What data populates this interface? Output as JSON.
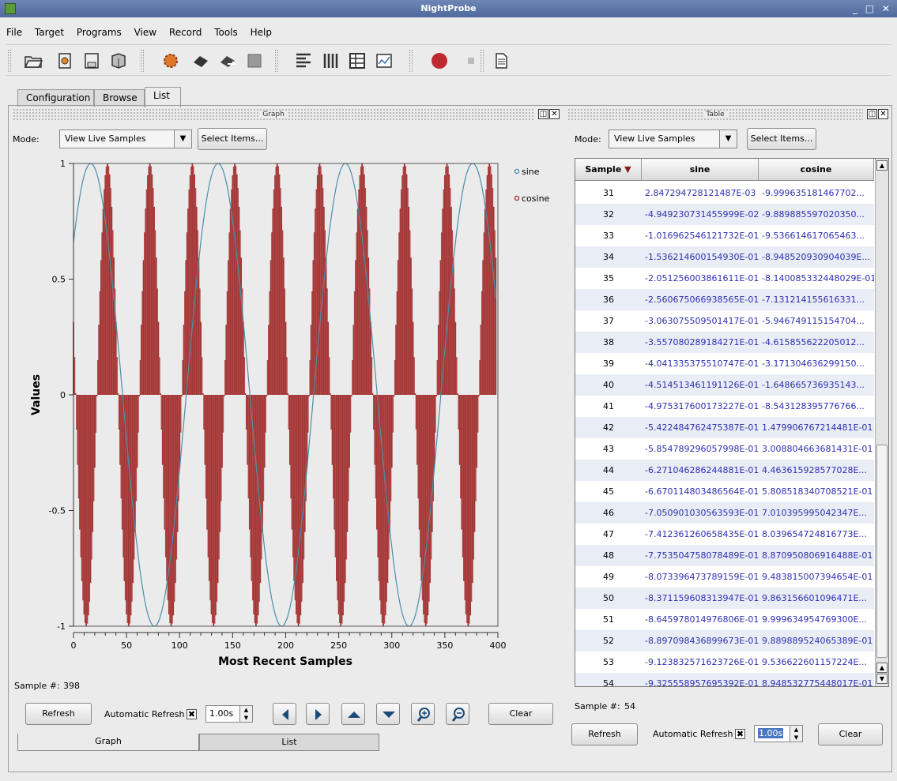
{
  "window": {
    "title": "NightProbe"
  },
  "menu": [
    "File",
    "Target",
    "Programs",
    "View",
    "Record",
    "Tools",
    "Help"
  ],
  "toolbar_icons": [
    "open-folder-icon",
    "target-icon",
    "save-icon",
    "cube-icon",
    "gear-icon",
    "chip-icon",
    "chip-arrow-icon",
    "memory-icon",
    "align-left-icon",
    "columns-icon",
    "table-icon",
    "graph-icon",
    "record-icon",
    "stop-icon",
    "document-icon"
  ],
  "tabs": [
    {
      "label": "Configuration",
      "active": false
    },
    {
      "label": "Browse",
      "active": false
    },
    {
      "label": "List",
      "active": true
    }
  ],
  "graph_panel": {
    "title": "Graph",
    "mode_label": "Mode:",
    "mode_value": "View Live Samples",
    "select_items": "Select Items...",
    "sample_label": "Sample #:",
    "sample_value": "398",
    "refresh": "Refresh",
    "auto_refresh_label": "Automatic Refresh",
    "auto_refresh_checked": "✖",
    "interval": "1.00s",
    "clear": "Clear",
    "bottom_tabs": [
      "Graph",
      "List"
    ]
  },
  "chart_data": {
    "type": "line",
    "title": "",
    "xlabel": "Most Recent Samples",
    "ylabel": "Values",
    "xlim": [
      0,
      400
    ],
    "ylim": [
      -1,
      1
    ],
    "xticks": [
      "0",
      "50",
      "100",
      "150",
      "200",
      "250",
      "300",
      "350",
      "400"
    ],
    "yticks": [
      "1",
      "0.5",
      "0",
      "-0.5",
      "-1"
    ],
    "grid": false,
    "legend_position": "top-right",
    "series": [
      {
        "name": "sine",
        "style": "line",
        "color": "#4a8fab",
        "function": "sin",
        "period_samples": 120,
        "phase_at_0": 0.72
      },
      {
        "name": "cosine",
        "style": "bars",
        "color": "#a03535",
        "function": "cos",
        "period_samples": 40,
        "phase_at_0": 1.25
      }
    ]
  },
  "table_panel": {
    "title": "Table",
    "mode_label": "Mode:",
    "mode_value": "View Live Samples",
    "select_items": "Select Items...",
    "headers": [
      "Sample",
      "sine",
      "cosine"
    ],
    "rows": [
      [
        "31",
        "2.847294728121487E-03",
        "-9.999635181467702..."
      ],
      [
        "32",
        "-4.949230731455999E-02",
        "-9.889885597020350..."
      ],
      [
        "33",
        "-1.016962546121732E-01",
        "-9.536614617065463..."
      ],
      [
        "34",
        "-1.536214600154930E-01",
        "-8.948520930904039E..."
      ],
      [
        "35",
        "-2.051256003861611E-01",
        "-8.140085332448029E-01"
      ],
      [
        "36",
        "-2.560675066938565E-01",
        "-7.131214155616331..."
      ],
      [
        "37",
        "-3.063075509501417E-01",
        "-5.946749115154704..."
      ],
      [
        "38",
        "-3.557080289184271E-01",
        "-4.615855622205012..."
      ],
      [
        "39",
        "-4.041335375510747E-01",
        "-3.171304636299150..."
      ],
      [
        "40",
        "-4.514513461191126E-01",
        "-1.648665736935143..."
      ],
      [
        "41",
        "-4.975317600173227E-01",
        "-8.543128395776766..."
      ],
      [
        "42",
        "-5.422484762475387E-01",
        "1.479906767214481E-01"
      ],
      [
        "43",
        "-5.854789296057998E-01",
        "3.008804663681431E-01"
      ],
      [
        "44",
        "-6.271046286244881E-01",
        "4.463615928577028E..."
      ],
      [
        "45",
        "-6.670114803486564E-01",
        "5.808518340708521E-01"
      ],
      [
        "46",
        "-7.050901030563593E-01",
        "7.010395995042347E..."
      ],
      [
        "47",
        "-7.412361260658435E-01",
        "8.039654724816773E..."
      ],
      [
        "48",
        "-7.753504758078489E-01",
        "8.870950806916488E-01"
      ],
      [
        "49",
        "-8.073396473789159E-01",
        "9.483815007394654E-01"
      ],
      [
        "50",
        "-8.371159608313947E-01",
        "9.863156601096471E..."
      ],
      [
        "51",
        "-8.645978014976806E-01",
        "9.999634954769300E..."
      ],
      [
        "52",
        "-8.897098436899673E-01",
        "9.889889524065389E-01"
      ],
      [
        "53",
        "-9.123832571623726E-01",
        "9.536622601157224E..."
      ],
      [
        "54",
        "-9.325558957695392E-01",
        "8.948532775448017E-01"
      ]
    ],
    "sample_label": "Sample #:",
    "sample_value": "54",
    "refresh": "Refresh",
    "auto_refresh_label": "Automatic Refresh",
    "auto_refresh_checked": "✖",
    "interval": "1.00s",
    "clear": "Clear"
  }
}
